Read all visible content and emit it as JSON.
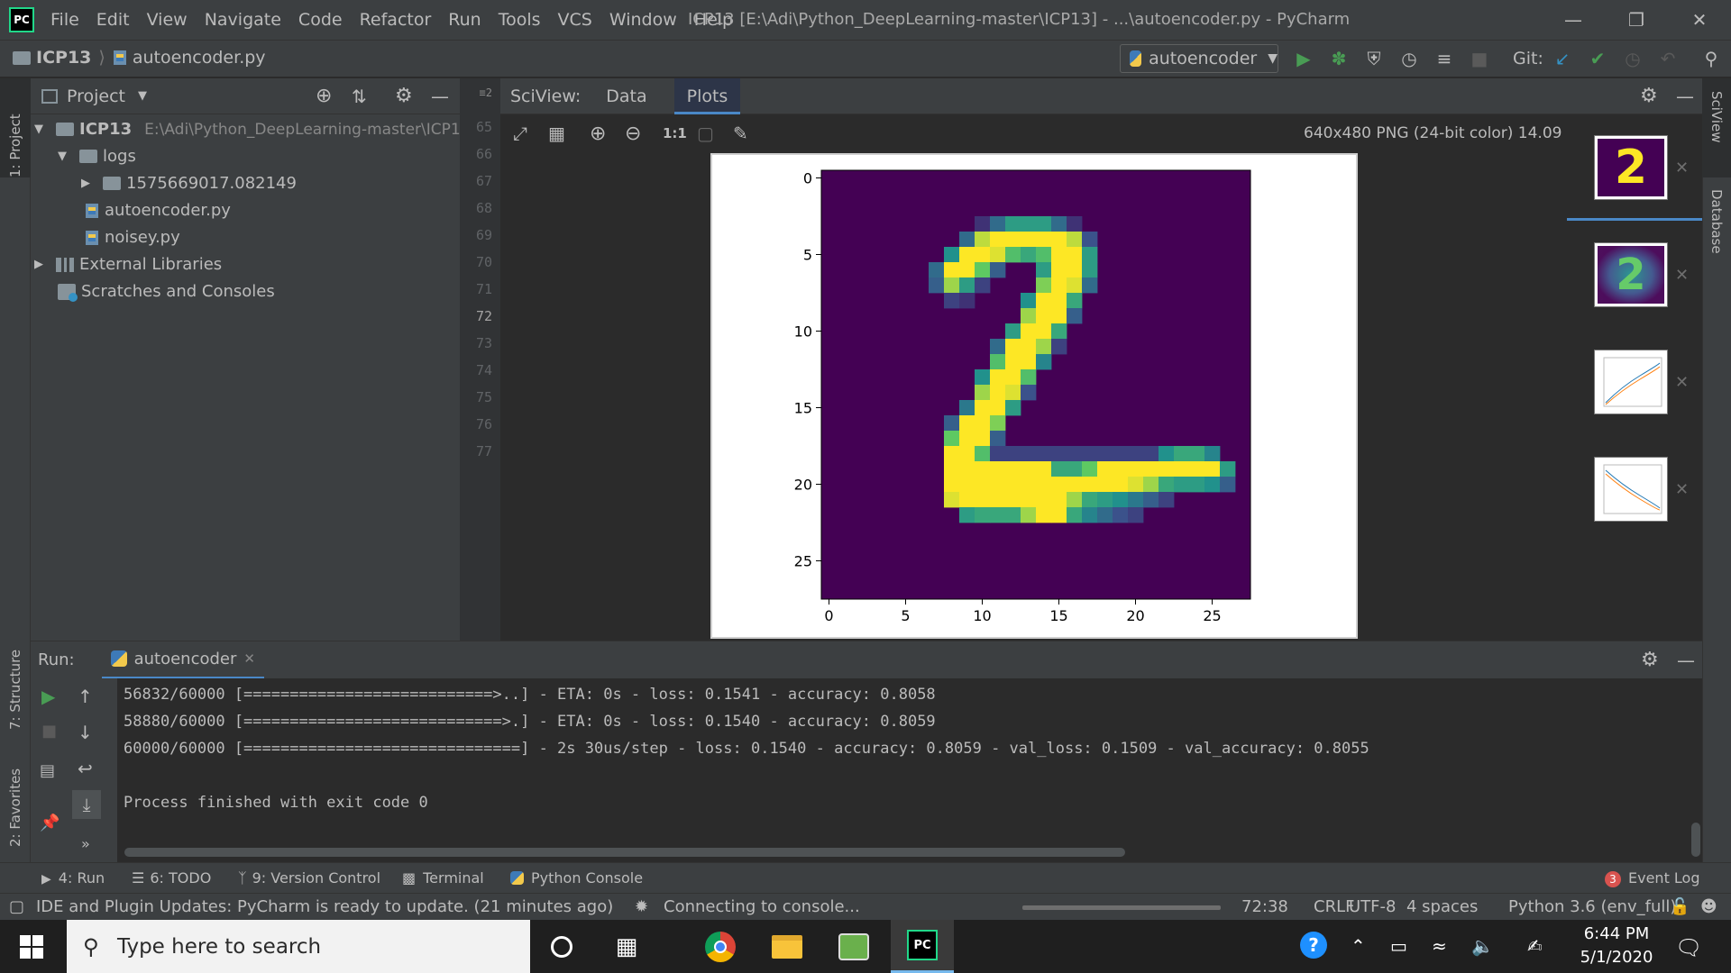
{
  "window": {
    "title": "ICP13 [E:\\Adi\\Python_DeepLearning-master\\ICP13] - ...\\autoencoder.py - PyCharm",
    "menu": [
      "File",
      "Edit",
      "View",
      "Navigate",
      "Code",
      "Refactor",
      "Run",
      "Tools",
      "VCS",
      "Window",
      "Help"
    ]
  },
  "navbar": {
    "project": "ICP13",
    "file": "autoencoder.py",
    "run_config": "autoencoder",
    "git_label": "Git:"
  },
  "left_strip": {
    "project_tab": "1: Project",
    "structure_tab": "7: Structure",
    "favorites_tab": "2: Favorites"
  },
  "right_strip": {
    "sciview_tab": "SciView",
    "database_tab": "Database"
  },
  "project_panel": {
    "title": "Project",
    "tree": [
      {
        "label": "ICP13",
        "path": "E:\\Adi\\Python_DeepLearning-master\\ICP13"
      },
      {
        "label": "logs"
      },
      {
        "label": "1575669017.082149"
      },
      {
        "label": "autoencoder.py"
      },
      {
        "label": "noisey.py"
      },
      {
        "label": "External Libraries"
      },
      {
        "label": "Scratches and Consoles"
      }
    ]
  },
  "gutter": {
    "lines": [
      "65",
      "66",
      "67",
      "68",
      "69",
      "70",
      "71",
      "72",
      "73",
      "74",
      "75",
      "76",
      "77"
    ],
    "current": "72"
  },
  "sciview": {
    "label": "SciView:",
    "tabs": [
      "Data",
      "Plots"
    ],
    "active_tab": "Plots",
    "zoom_label": "1:1",
    "image_info": "640x480 PNG (24-bit color) 14.09 kB"
  },
  "chart_data": {
    "type": "heatmap",
    "title": "",
    "xlabel": "",
    "ylabel": "",
    "xticks": [
      "0",
      "5",
      "10",
      "15",
      "20",
      "25"
    ],
    "yticks": [
      "0",
      "5",
      "10",
      "15",
      "20",
      "25"
    ],
    "xlim": [
      -0.5,
      27.5
    ],
    "ylim": [
      27.5,
      -0.5
    ],
    "colormap": "viridis",
    "rows": [
      "............................",
      "............................",
      "............................",
      "............................",
      "............................",
      "............................",
      "............................",
      "............................",
      "............................",
      "................>#>.........",
      "..............>#####........",
      "........................",
      "............................",
      "............................",
      "............................",
      "............................",
      "............................",
      "............................",
      "............................",
      "............................",
      "............................",
      "............................",
      "............................",
      "............................",
      "............................",
      "............................",
      "............................",
      "............................"
    ],
    "pixels": [
      [
        3,
        10,
        0.15
      ],
      [
        3,
        11,
        0.35
      ],
      [
        3,
        12,
        0.55
      ],
      [
        3,
        13,
        0.55
      ],
      [
        3,
        14,
        0.55
      ],
      [
        3,
        15,
        0.35
      ],
      [
        3,
        16,
        0.15
      ],
      [
        4,
        9,
        0.35
      ],
      [
        4,
        10,
        0.9
      ],
      [
        4,
        11,
        1.0
      ],
      [
        4,
        12,
        1.0
      ],
      [
        4,
        13,
        1.0
      ],
      [
        4,
        14,
        1.0
      ],
      [
        4,
        15,
        1.0
      ],
      [
        4,
        16,
        0.9
      ],
      [
        4,
        17,
        0.25
      ],
      [
        5,
        8,
        0.5
      ],
      [
        5,
        9,
        1.0
      ],
      [
        5,
        10,
        1.0
      ],
      [
        5,
        11,
        0.95
      ],
      [
        5,
        12,
        0.7
      ],
      [
        5,
        13,
        0.6
      ],
      [
        5,
        14,
        0.7
      ],
      [
        5,
        15,
        1.0
      ],
      [
        5,
        16,
        1.0
      ],
      [
        5,
        17,
        0.55
      ],
      [
        6,
        7,
        0.35
      ],
      [
        6,
        8,
        1.0
      ],
      [
        6,
        9,
        1.0
      ],
      [
        6,
        10,
        0.75
      ],
      [
        6,
        11,
        0.3
      ],
      [
        6,
        14,
        0.55
      ],
      [
        6,
        15,
        1.0
      ],
      [
        6,
        16,
        1.0
      ],
      [
        6,
        17,
        0.55
      ],
      [
        7,
        7,
        0.3
      ],
      [
        7,
        8,
        0.85
      ],
      [
        7,
        9,
        0.55
      ],
      [
        7,
        10,
        0.2
      ],
      [
        7,
        14,
        0.8
      ],
      [
        7,
        15,
        1.0
      ],
      [
        7,
        16,
        0.95
      ],
      [
        7,
        17,
        0.35
      ],
      [
        8,
        8,
        0.2
      ],
      [
        8,
        9,
        0.15
      ],
      [
        8,
        13,
        0.5
      ],
      [
        8,
        14,
        1.0
      ],
      [
        8,
        15,
        1.0
      ],
      [
        8,
        16,
        0.6
      ],
      [
        9,
        13,
        0.85
      ],
      [
        9,
        14,
        1.0
      ],
      [
        9,
        15,
        1.0
      ],
      [
        9,
        16,
        0.3
      ],
      [
        10,
        12,
        0.55
      ],
      [
        10,
        13,
        1.0
      ],
      [
        10,
        14,
        1.0
      ],
      [
        10,
        15,
        0.6
      ],
      [
        11,
        11,
        0.35
      ],
      [
        11,
        12,
        1.0
      ],
      [
        11,
        13,
        1.0
      ],
      [
        11,
        14,
        0.85
      ],
      [
        11,
        15,
        0.2
      ],
      [
        12,
        11,
        0.7
      ],
      [
        12,
        12,
        1.0
      ],
      [
        12,
        13,
        1.0
      ],
      [
        12,
        14,
        0.45
      ],
      [
        13,
        10,
        0.5
      ],
      [
        13,
        11,
        1.0
      ],
      [
        13,
        12,
        1.0
      ],
      [
        13,
        13,
        0.7
      ],
      [
        14,
        10,
        0.85
      ],
      [
        14,
        11,
        1.0
      ],
      [
        14,
        12,
        0.95
      ],
      [
        14,
        13,
        0.25
      ],
      [
        15,
        9,
        0.4
      ],
      [
        15,
        10,
        1.0
      ],
      [
        15,
        11,
        1.0
      ],
      [
        15,
        12,
        0.55
      ],
      [
        16,
        8,
        0.3
      ],
      [
        16,
        9,
        1.0
      ],
      [
        16,
        10,
        1.0
      ],
      [
        16,
        11,
        0.8
      ],
      [
        17,
        8,
        0.75
      ],
      [
        17,
        9,
        1.0
      ],
      [
        17,
        10,
        1.0
      ],
      [
        17,
        11,
        0.3
      ],
      [
        18,
        8,
        1.0
      ],
      [
        18,
        9,
        1.0
      ],
      [
        18,
        10,
        0.7
      ],
      [
        18,
        11,
        0.2
      ],
      [
        18,
        12,
        0.2
      ],
      [
        18,
        13,
        0.2
      ],
      [
        18,
        14,
        0.2
      ],
      [
        18,
        15,
        0.2
      ],
      [
        18,
        16,
        0.2
      ],
      [
        18,
        17,
        0.2
      ],
      [
        18,
        18,
        0.2
      ],
      [
        18,
        19,
        0.2
      ],
      [
        18,
        20,
        0.2
      ],
      [
        18,
        21,
        0.2
      ],
      [
        18,
        22,
        0.5
      ],
      [
        18,
        23,
        0.6
      ],
      [
        18,
        24,
        0.6
      ],
      [
        18,
        25,
        0.45
      ],
      [
        19,
        8,
        1.0
      ],
      [
        19,
        9,
        1.0
      ],
      [
        19,
        10,
        1.0
      ],
      [
        19,
        11,
        1.0
      ],
      [
        19,
        12,
        1.0
      ],
      [
        19,
        13,
        1.0
      ],
      [
        19,
        14,
        1.0
      ],
      [
        19,
        15,
        0.6
      ],
      [
        19,
        16,
        0.6
      ],
      [
        19,
        17,
        0.75
      ],
      [
        19,
        18,
        1.0
      ],
      [
        19,
        19,
        1.0
      ],
      [
        19,
        20,
        1.0
      ],
      [
        19,
        21,
        1.0
      ],
      [
        19,
        22,
        1.0
      ],
      [
        19,
        23,
        1.0
      ],
      [
        19,
        24,
        1.0
      ],
      [
        19,
        25,
        1.0
      ],
      [
        19,
        26,
        0.55
      ],
      [
        20,
        8,
        1.0
      ],
      [
        20,
        9,
        1.0
      ],
      [
        20,
        10,
        1.0
      ],
      [
        20,
        11,
        1.0
      ],
      [
        20,
        12,
        1.0
      ],
      [
        20,
        13,
        1.0
      ],
      [
        20,
        14,
        1.0
      ],
      [
        20,
        15,
        1.0
      ],
      [
        20,
        16,
        1.0
      ],
      [
        20,
        17,
        1.0
      ],
      [
        20,
        18,
        1.0
      ],
      [
        20,
        19,
        1.0
      ],
      [
        20,
        20,
        0.95
      ],
      [
        20,
        21,
        0.85
      ],
      [
        20,
        22,
        0.6
      ],
      [
        20,
        23,
        0.55
      ],
      [
        20,
        24,
        0.55
      ],
      [
        20,
        25,
        0.5
      ],
      [
        20,
        26,
        0.3
      ],
      [
        21,
        8,
        0.95
      ],
      [
        21,
        9,
        1.0
      ],
      [
        21,
        10,
        1.0
      ],
      [
        21,
        11,
        1.0
      ],
      [
        21,
        12,
        1.0
      ],
      [
        21,
        13,
        1.0
      ],
      [
        21,
        14,
        1.0
      ],
      [
        21,
        15,
        1.0
      ],
      [
        21,
        16,
        0.85
      ],
      [
        21,
        17,
        0.6
      ],
      [
        21,
        18,
        0.55
      ],
      [
        21,
        19,
        0.5
      ],
      [
        21,
        20,
        0.4
      ],
      [
        21,
        21,
        0.3
      ],
      [
        21,
        22,
        0.2
      ],
      [
        22,
        9,
        0.55
      ],
      [
        22,
        10,
        0.6
      ],
      [
        22,
        11,
        0.6
      ],
      [
        22,
        12,
        0.6
      ],
      [
        22,
        13,
        0.85
      ],
      [
        22,
        14,
        1.0
      ],
      [
        22,
        15,
        1.0
      ],
      [
        22,
        16,
        0.6
      ],
      [
        22,
        17,
        0.45
      ],
      [
        22,
        18,
        0.35
      ],
      [
        22,
        19,
        0.25
      ],
      [
        22,
        20,
        0.2
      ]
    ]
  },
  "run_panel": {
    "label": "Run:",
    "tab": "autoencoder",
    "lines": [
      "56832/60000 [===========================>..] - ETA: 0s - loss: 0.1541 - accuracy: 0.8058",
      "58880/60000 [============================>.] - ETA: 0s - loss: 0.1540 - accuracy: 0.8059",
      "60000/60000 [==============================] - 2s 30us/step - loss: 0.1540 - accuracy: 0.8059 - val_loss: 0.1509 - val_accuracy: 0.8055",
      "",
      "Process finished with exit code 0"
    ]
  },
  "tool_tabs": {
    "run": "4: Run",
    "todo": "6: TODO",
    "vcs": "9: Version Control",
    "terminal": "Terminal",
    "python_console": "Python Console",
    "event_log": "Event Log",
    "event_count": "3"
  },
  "status_bar": {
    "message": "IDE and Plugin Updates: PyCharm is ready to update. (21 minutes ago)",
    "progress": "Connecting to console...",
    "position": "72:38",
    "line_sep": "CRLF",
    "encoding": "UTF-8",
    "indent": "4 spaces",
    "interpreter": "Python 3.6 (env_full)"
  },
  "taskbar": {
    "search_placeholder": "Type here to search",
    "time": "6:44 PM",
    "date": "5/1/2020"
  },
  "colors": {
    "viridis_low": "#440154",
    "viridis_mid": "#21918c",
    "viridis_high": "#fde725",
    "run_green": "#499c54",
    "git_blue": "#3592c4",
    "accent_tab": "#4a88c7"
  }
}
